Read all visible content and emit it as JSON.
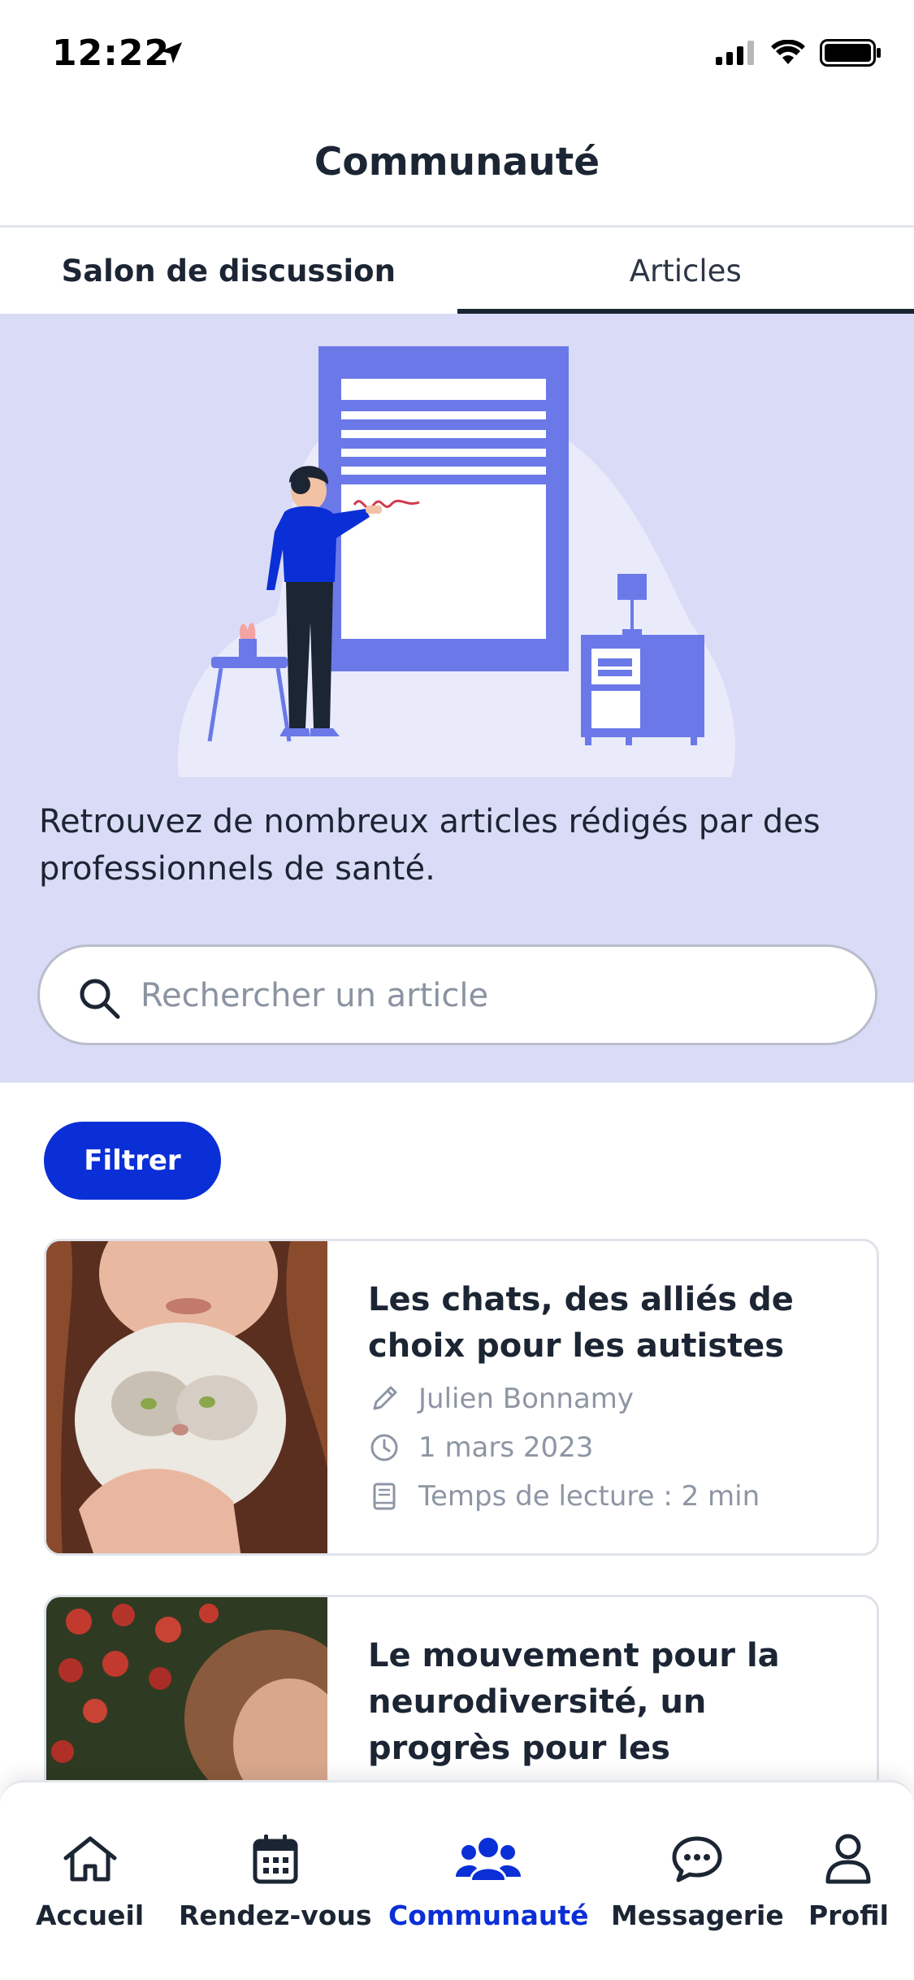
{
  "status_bar": {
    "time": "12:22"
  },
  "header": {
    "title": "Communauté"
  },
  "tabs": [
    {
      "label": "Salon de discussion",
      "active": false
    },
    {
      "label": "Articles",
      "active": true
    }
  ],
  "hero": {
    "description": "Retrouvez de nombreux articles rédigés par des professionnels de santé.",
    "search": {
      "placeholder": "Rechercher un article",
      "value": ""
    }
  },
  "filter": {
    "label": "Filtrer"
  },
  "articles": [
    {
      "title": "Les chats, des alliés de choix pour les autistes",
      "author": "Julien Bonnamy",
      "date": "1 mars 2023",
      "reading_time": "Temps de lecture : 2 min"
    },
    {
      "title": "Le mouvement pour la neurodiversité, un progrès pour les personnes"
    }
  ],
  "bottom_nav": [
    {
      "label": "Accueil",
      "icon": "home-icon",
      "active": false
    },
    {
      "label": "Rendez-vous",
      "icon": "calendar-icon",
      "active": false
    },
    {
      "label": "Communauté",
      "icon": "users-icon",
      "active": true
    },
    {
      "label": "Messagerie",
      "icon": "chat-icon",
      "active": false
    },
    {
      "label": "Profil",
      "icon": "user-icon",
      "active": false
    }
  ],
  "colors": {
    "accent": "#0b2fd6",
    "hero_bg": "#dadcf7",
    "illustration": "#6b79e8",
    "text": "#1c2533",
    "muted": "#8d96a4"
  }
}
